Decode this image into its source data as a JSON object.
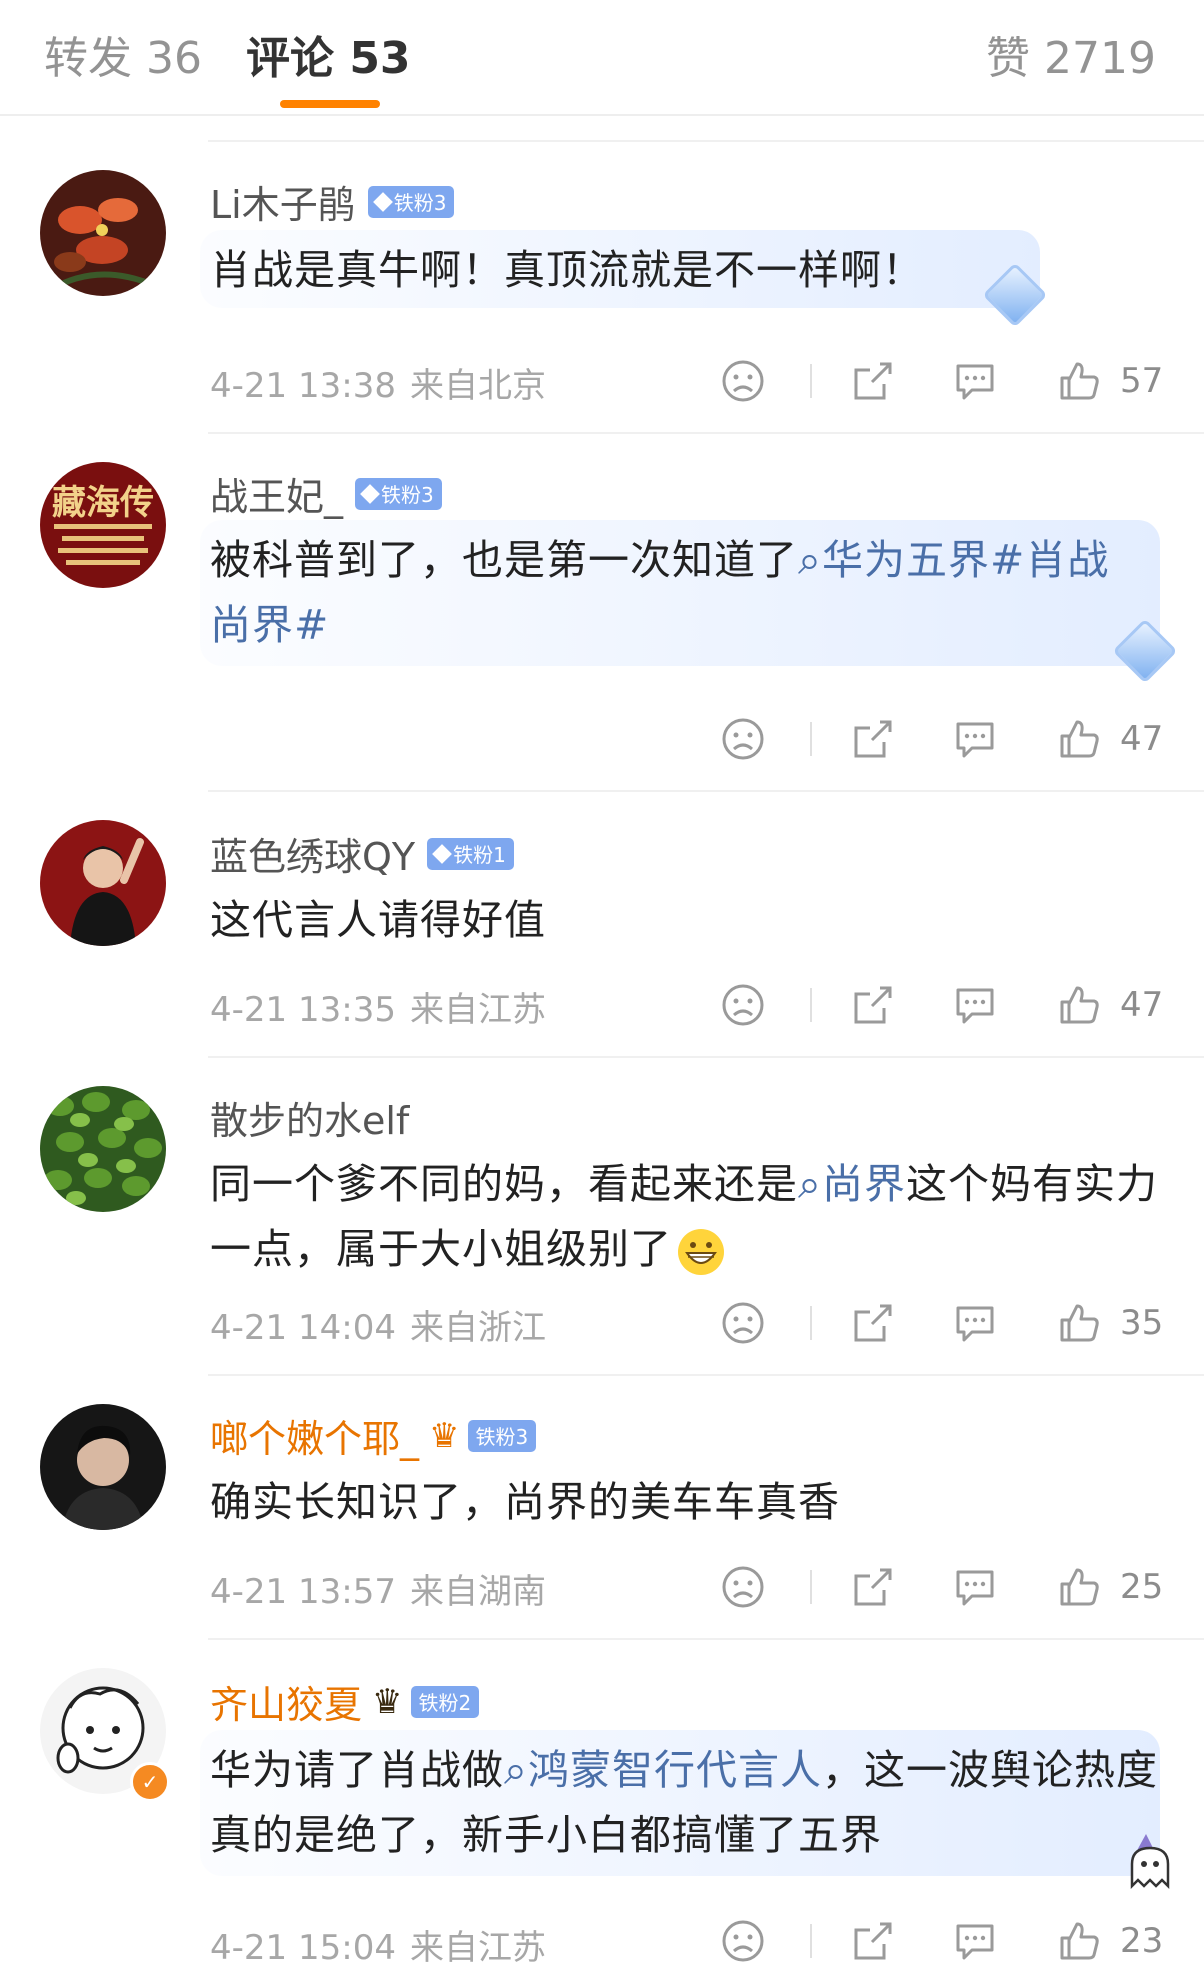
{
  "tabs": {
    "repost": "转发 36",
    "comments": "评论 53",
    "likes": "赞 2719"
  },
  "colors": {
    "accent": "#ff8200",
    "badge": "#7ea7ef",
    "link": "#4a6fa8",
    "username_gold": "#e87400"
  },
  "comments": [
    {
      "user": "Li木子鹃",
      "badge": "铁粉3",
      "text": "肖战是真牛啊！真顶流就是不一样啊！",
      "time": "4-21 13:38",
      "location": "来自北京",
      "likes": "57"
    },
    {
      "user": "战王妃_",
      "badge": "铁粉3",
      "avatar_text": "藏海传",
      "text_before": "被科普到了，也是第一次知道了",
      "link": "华为五界#肖战 尚界#",
      "likes": "47"
    },
    {
      "user": "蓝色绣球QY",
      "badge": "铁粉1",
      "text": "这代言人请得好值",
      "time": "4-21 13:35",
      "location": "来自江苏",
      "likes": "47"
    },
    {
      "user": "散步的水elf",
      "text_before": "同一个爹不同的妈，看起来还是",
      "link": "尚界",
      "text_after": "这个妈有实力一点，属于大小姐级别了",
      "time": "4-21 14:04",
      "location": "来自浙江",
      "likes": "35"
    },
    {
      "user": "啷个嫩个耶_",
      "badge": "铁粉3",
      "text": "确实长知识了，尚界的美车车真香",
      "time": "4-21 13:57",
      "location": "来自湖南",
      "likes": "25"
    },
    {
      "user": "齐山狡夏",
      "badge": "铁粉2",
      "text_before": "华为请了肖战做",
      "link": "鸿蒙智行代言人",
      "text_after": "，这一波舆论热度真的是绝了，新手小白都搞懂了五界",
      "time": "4-21 15:04",
      "location": "来自江苏",
      "likes": "23"
    }
  ]
}
